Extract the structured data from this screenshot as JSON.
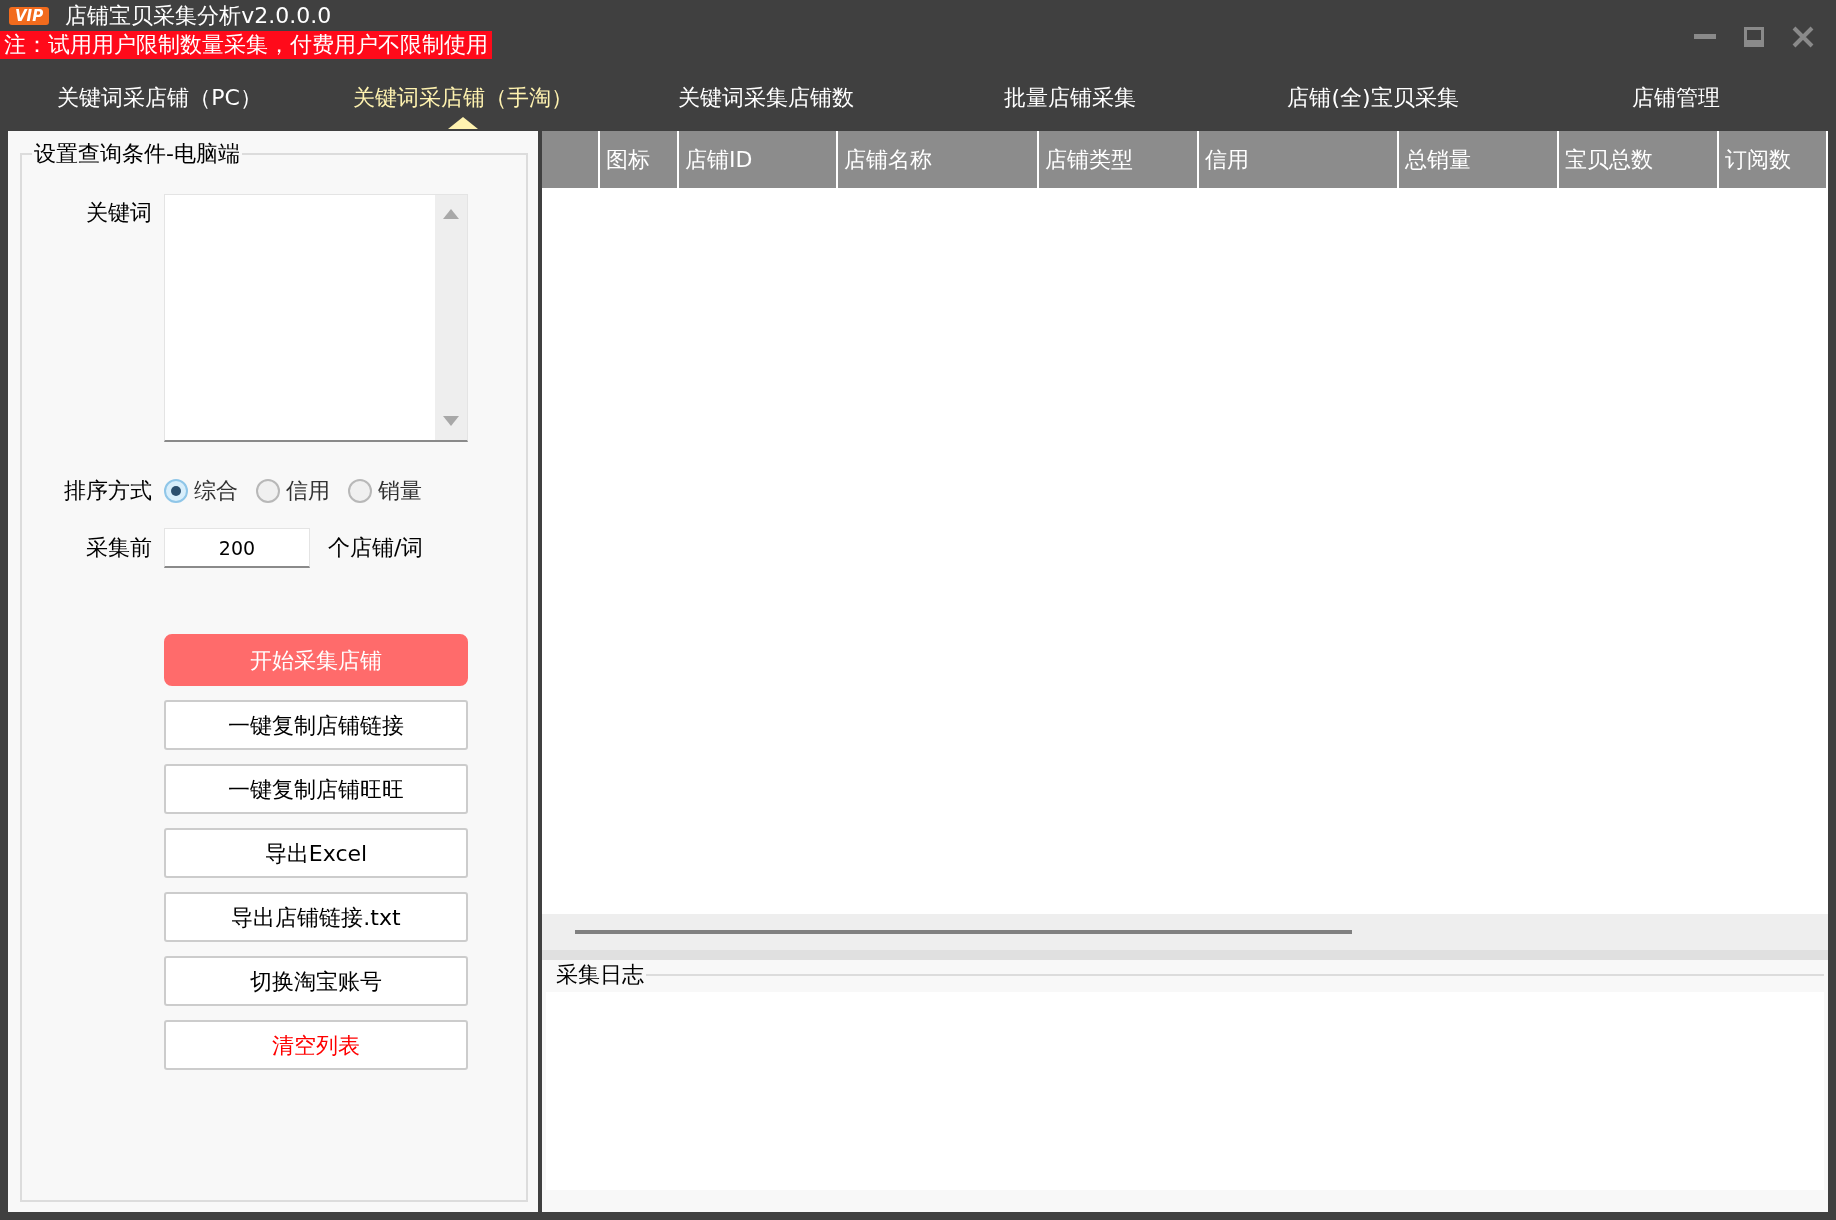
{
  "window": {
    "badge": "VIP",
    "title": "店铺宝贝采集分析v2.0.0.0",
    "notice": "注：试用用户限制数量采集，付费用户不限制使用"
  },
  "tabs": [
    {
      "label": "关键词采店铺（PC）",
      "selected": false
    },
    {
      "label": "关键词采店铺（手淘）",
      "selected": true
    },
    {
      "label": "关键词采集店铺数",
      "selected": false
    },
    {
      "label": "批量店铺采集",
      "selected": false
    },
    {
      "label": "店铺(全)宝贝采集",
      "selected": false
    },
    {
      "label": "店铺管理",
      "selected": false
    }
  ],
  "query_panel": {
    "title": "设置查询条件-电脑端",
    "keyword_label": "关键词",
    "sort_label": "排序方式",
    "sort_options": [
      {
        "label": "综合",
        "selected": true
      },
      {
        "label": "信用",
        "selected": false
      },
      {
        "label": "销量",
        "selected": false
      }
    ],
    "count_prefix": "采集前",
    "count_value": "200",
    "count_suffix": "个店铺/词"
  },
  "buttons": [
    {
      "label": "开始采集店铺",
      "kind": "primary"
    },
    {
      "label": "一键复制店铺链接",
      "kind": "normal"
    },
    {
      "label": "一键复制店铺旺旺",
      "kind": "normal"
    },
    {
      "label": "导出Excel",
      "kind": "normal"
    },
    {
      "label": "导出店铺链接.txt",
      "kind": "normal"
    },
    {
      "label": "切换淘宝账号",
      "kind": "normal"
    },
    {
      "label": "清空列表",
      "kind": "danger"
    }
  ],
  "table": {
    "columns": [
      "图标",
      "店铺ID",
      "店铺名称",
      "店铺类型",
      "信用",
      "总销量",
      "宝贝总数",
      "订阅数"
    ]
  },
  "log": {
    "title": "采集日志"
  }
}
